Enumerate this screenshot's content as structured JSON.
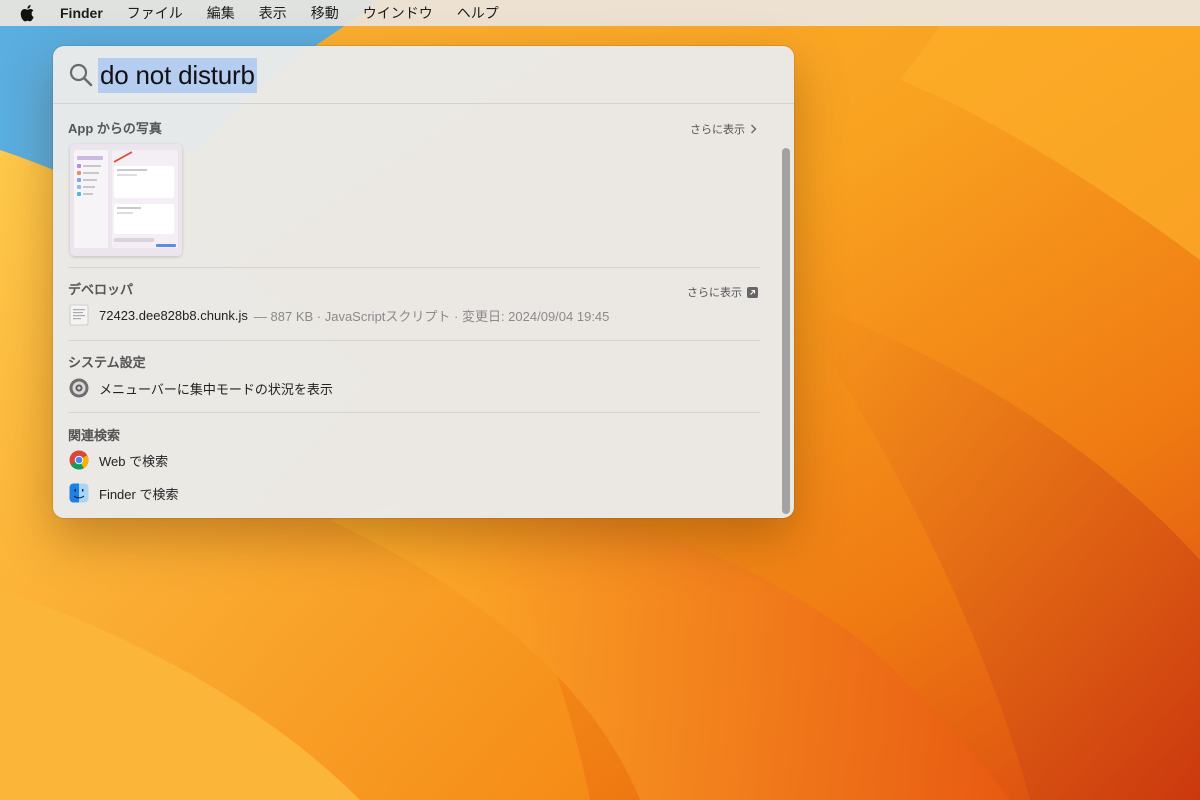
{
  "menubar": {
    "app_name": "Finder",
    "items": [
      "ファイル",
      "編集",
      "表示",
      "移動",
      "ウインドウ",
      "ヘルプ"
    ]
  },
  "spotlight": {
    "query": "do not disturb",
    "sections": {
      "photos": {
        "title": "App からの写真",
        "more_label": "さらに表示"
      },
      "developer": {
        "title": "デベロッパ",
        "more_label": "さらに表示",
        "file_name": "72423.dee828b8.chunk.js",
        "file_meta": "— 887 KB · JavaScriptスクリプト · 変更日: 2024/09/04 19:45"
      },
      "system_settings": {
        "title": "システム設定",
        "item_label": "メニューバーに集中モードの状況を表示"
      },
      "related": {
        "title": "関連検索",
        "web_label": "Web で検索",
        "finder_label": "Finder で検索"
      }
    }
  },
  "icons": [
    "apple-icon",
    "search-icon",
    "document-icon",
    "settings-gear-icon",
    "chrome-icon",
    "finder-icon",
    "chevron-right-icon",
    "open-arrow-icon"
  ]
}
